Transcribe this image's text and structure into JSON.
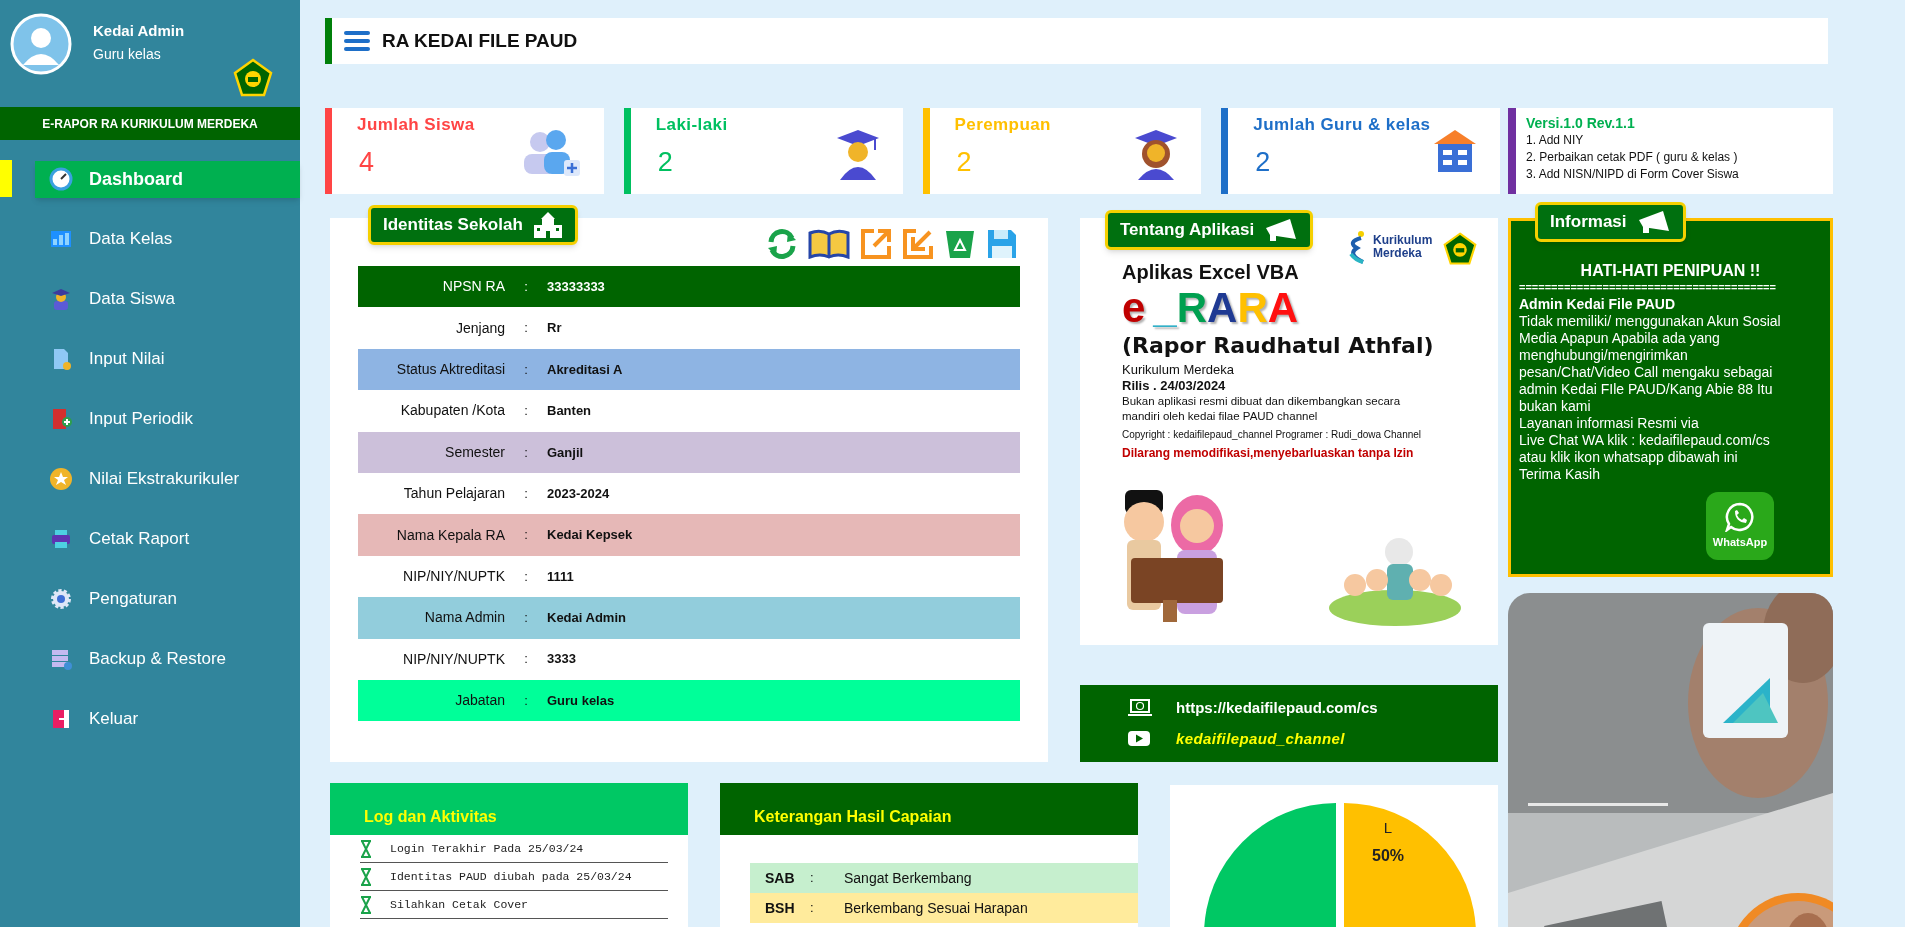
{
  "sidebar": {
    "user": {
      "name": "Kedai Admin",
      "role": "Guru kelas"
    },
    "app_banner": "E-RAPOR RA KURIKULUM MERDEKA",
    "items": [
      {
        "label": "Dashboard",
        "selected": true
      },
      {
        "label": "Data Kelas",
        "selected": false
      },
      {
        "label": "Data Siswa",
        "selected": false
      },
      {
        "label": "Input Nilai",
        "selected": false
      },
      {
        "label": "Input Periodik",
        "selected": false
      },
      {
        "label": "Nilai Ekstrakurikuler",
        "selected": false
      },
      {
        "label": "Cetak Raport",
        "selected": false
      },
      {
        "label": "Pengaturan",
        "selected": false
      },
      {
        "label": "Backup & Restore",
        "selected": false
      },
      {
        "label": "Keluar",
        "selected": false
      }
    ]
  },
  "header": {
    "title": "RA KEDAI FILE PAUD"
  },
  "stats": [
    {
      "label": "Jumlah Siswa",
      "value": "4",
      "color": "#ff4545"
    },
    {
      "label": "Laki-laki",
      "value": "2",
      "color": "#00c060"
    },
    {
      "label": "Perempuan",
      "value": "2",
      "color": "#ffc000"
    },
    {
      "label": "Jumlah Guru & kelas",
      "value": "2",
      "color": "#1e6fc8"
    }
  ],
  "version": {
    "title": "Versi.1.0 Rev.1.1",
    "notes": [
      "1. Add NIY",
      "2. Perbaikan cetak PDF ( guru & kelas )",
      "3. Add NISN/NIPD di Form Cover Siswa"
    ]
  },
  "identitas": {
    "badge": "Identitas Sekolah",
    "rows": [
      {
        "label": "NPSN RA",
        "separator": ":",
        "value": "33333333",
        "color": "#006400"
      },
      {
        "label": "Jenjang",
        "separator": ":",
        "value": "Rr",
        "color": "#ffffff"
      },
      {
        "label": "Status Aktreditasi",
        "separator": ":",
        "value": "Akreditasi A",
        "color": "#8eb4e3"
      },
      {
        "label": "Kabupaten /Kota",
        "separator": ":",
        "value": "Banten",
        "color": "#ffffff"
      },
      {
        "label": "Semester",
        "separator": ":",
        "value": "Ganjil",
        "color": "#ccc0da"
      },
      {
        "label": "Tahun Pelajaran",
        "separator": ":",
        "value": "2023-2024",
        "color": "#ffffff"
      },
      {
        "label": "Nama Kepala RA",
        "separator": ":",
        "value": "Kedai Kepsek",
        "color": "#e6b8b7"
      },
      {
        "label": "NIP/NIY/NUPTK",
        "separator": ":",
        "value": "1111",
        "color": "#ffffff"
      },
      {
        "label": "Nama Admin",
        "separator": ":",
        "value": "Kedai Admin",
        "color": "#92cddc"
      },
      {
        "label": "NIP/NIY/NUPTK",
        "separator": ":",
        "value": "3333",
        "color": "#ffffff"
      },
      {
        "label": "Jabatan",
        "separator": ":",
        "value": "Guru kelas",
        "color": "#00ff99"
      }
    ]
  },
  "tentang": {
    "badge": "Tentang Aplikasi",
    "logo_text": [
      "Kurikulum",
      "Merdeka"
    ],
    "heading": "Aplikas Excel VBA",
    "app_name": [
      {
        "text": "e",
        "color": "#c00000"
      },
      {
        "text": "_",
        "color": "#31b0c8"
      },
      {
        "text": "R",
        "color": "#00a050"
      },
      {
        "text": "A",
        "color": "#1f3a93"
      },
      {
        "text": "R",
        "color": "#ffc000"
      },
      {
        "text": "A",
        "color": "#ff1010"
      }
    ],
    "subtitle": "(Rapor Raudhatul Athfal)",
    "curriculum": "Kurikulum Merdeka",
    "release": "Rilis . 24/03/2024",
    "disclaimer": [
      "Bukan aplikasi resmi dibuat dan dikembangkan secara",
      "mandiri oleh kedai filae PAUD channel"
    ],
    "copyright": "Copyright  : kedaifilepaud_channel Programer : Rudi_dowa Channel",
    "warning": "Dilarang memodifikasi,menyebarluaskan tanpa Izin"
  },
  "links": [
    {
      "kind": "web",
      "text": "https://kedaifilepaud.com/cs"
    },
    {
      "kind": "youtube",
      "text": "kedaifilepaud_channel"
    }
  ],
  "informasi": {
    "badge": "Informasi",
    "heading": "HATI-HATI PENIPUAN !!",
    "divider": "========================================",
    "sender": "Admin Kedai File PAUD",
    "lines": [
      "Tidak memiliki/ menggunakan Akun Sosial",
      "Media Apapun Apabila ada yang",
      "menghubungi/mengirimkan",
      "pesan/Chat/Video Call mengaku sebagai",
      "admin Kedai FIle PAUD/Kang Abie 88 Itu",
      "bukan kami",
      "Layanan informasi Resmi via",
      "Live Chat WA klik : kedaifilepaud.com/cs",
      "atau klik ikon whatsapp dibawah ini",
      "Terima Kasih"
    ],
    "button": "WhatsApp"
  },
  "log": {
    "title": "Log dan Aktivitas",
    "entries": [
      "Login Terakhir Pada 25/03/24",
      "Identitas PAUD diubah pada 25/03/24",
      "Silahkan Cetak Cover"
    ]
  },
  "keterangan": {
    "title": "Keterangan Hasil Capaian",
    "rows": [
      {
        "code": "SAB",
        "separator": ":",
        "desc": "Sangat Berkembang",
        "color": "#c6efce"
      },
      {
        "code": "BSH",
        "separator": ":",
        "desc": "Berkembang Sesuai Harapan",
        "color": "#ffeb9c"
      }
    ]
  },
  "pie": {
    "chart_data": {
      "type": "pie",
      "categories": [
        "L",
        null
      ],
      "values": [
        50,
        50
      ],
      "colors": [
        "#ffc000",
        "#00c864"
      ],
      "value_labels": [
        "50%",
        null
      ]
    }
  }
}
